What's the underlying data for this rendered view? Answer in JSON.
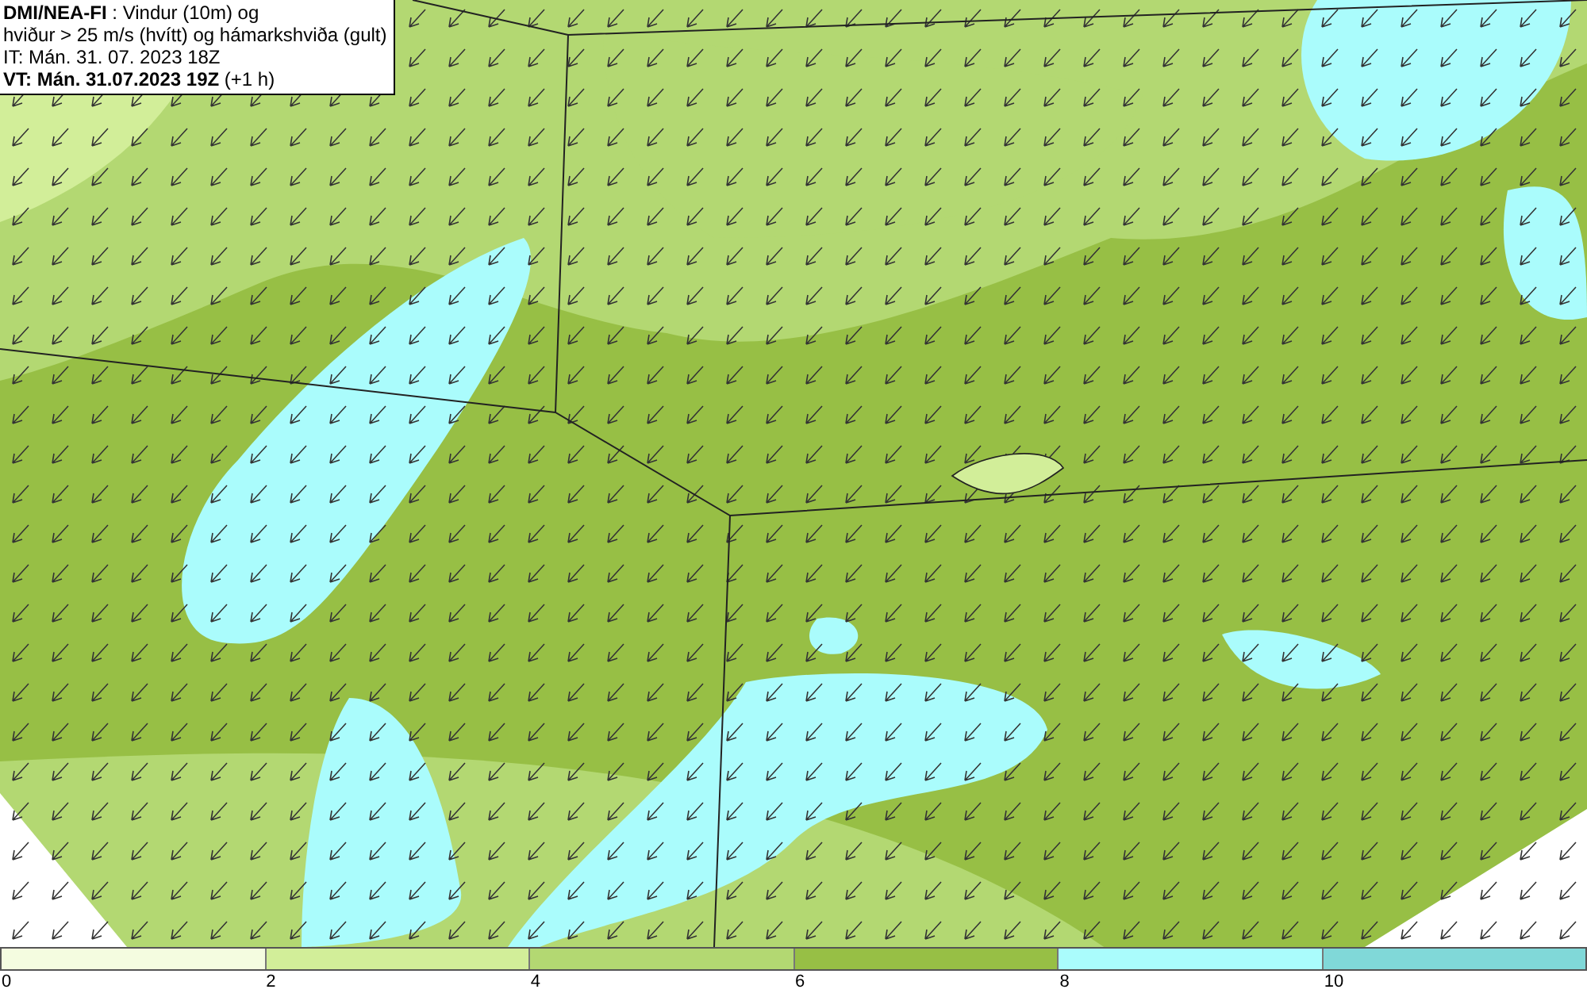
{
  "header": {
    "lines": [
      "**DMI/NEA-FI** : Vindur (10m) og",
      "hviður > 25 m/s (hvítt) og hámarkshviða (gult)",
      "IT: Mán. 31. 07. 2023 18Z",
      "**VT: Mán. 31.07.2023 19Z** (+1 h)"
    ]
  },
  "legend": {
    "bins": [
      {
        "color": "#f4fce0"
      },
      {
        "color": "#d2ee99"
      },
      {
        "color": "#b3d872"
      },
      {
        "color": "#97bf45"
      },
      {
        "color": "#aafcfc"
      },
      {
        "color": "#80d8d8"
      }
    ],
    "ticks": [
      "0",
      "2",
      "4",
      "6",
      "8",
      "10"
    ]
  }
}
